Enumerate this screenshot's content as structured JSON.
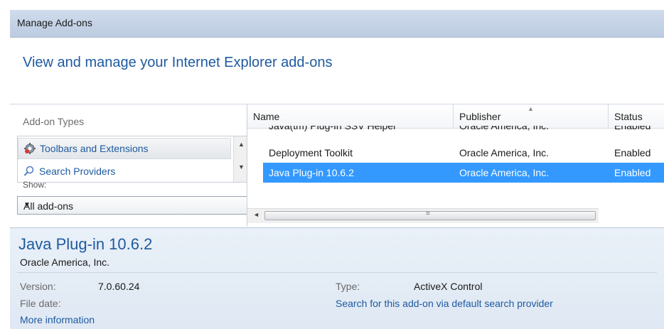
{
  "window": {
    "title": "Manage Add-ons"
  },
  "header": {
    "heading": "View and manage your Internet Explorer add-ons"
  },
  "addon_types": {
    "label": "Add-on Types",
    "items": [
      {
        "label": "Toolbars and Extensions",
        "selected": true,
        "icon": "gear-icon"
      },
      {
        "label": "Search Providers",
        "selected": false,
        "icon": "search-icon"
      }
    ]
  },
  "show": {
    "label": "Show:",
    "selected": "All add-ons"
  },
  "list": {
    "columns": [
      "Name",
      "Publisher",
      "Status"
    ],
    "rows": [
      {
        "name": "Java(tm) Plug-In SSV Helper",
        "publisher": "Oracle America, Inc.",
        "status": "Enabled"
      },
      {
        "name": "Deployment Toolkit",
        "publisher": "Oracle America, Inc.",
        "status": "Enabled"
      },
      {
        "name": "Java Plug-in 10.6.2",
        "publisher": "Oracle America, Inc.",
        "status": "Enabled"
      }
    ]
  },
  "details": {
    "name": "Java Plug-in 10.6.2",
    "publisher": "Oracle America, Inc.",
    "version_label": "Version:",
    "version_value": "7.0.60.24",
    "file_date_label": "File date:",
    "more_info_label": "More information",
    "type_label": "Type:",
    "type_value": "ActiveX Control",
    "search_link": "Search for this add-on via default search provider"
  },
  "colors": {
    "accent": "#1e5aa0",
    "selection": "#3399ff"
  }
}
